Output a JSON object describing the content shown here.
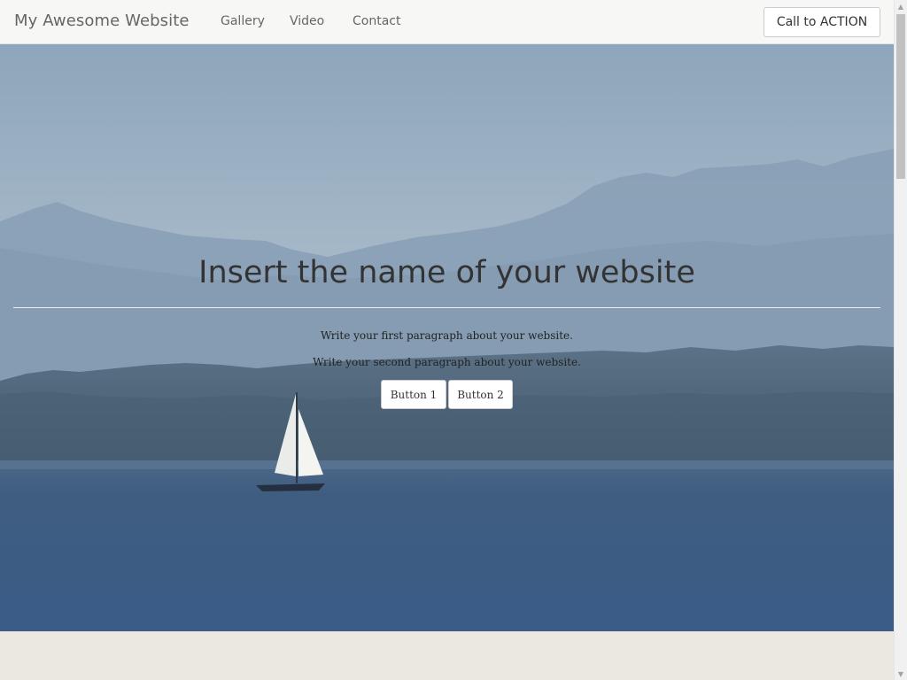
{
  "navbar": {
    "brand": "My Awesome Website",
    "links": [
      "Gallery",
      "Video",
      "Contact"
    ],
    "cta_label": "Call to ACTION"
  },
  "hero": {
    "title": "Insert the name of your website",
    "paragraph_1": "Write your first paragraph about your website.",
    "paragraph_2": "Write your second paragraph about your website.",
    "button_1": "Button 1",
    "button_2": "Button 2"
  },
  "icons": {
    "scroll_up": "scroll-up-arrow-icon",
    "scroll_down": "scroll-down-arrow-icon"
  },
  "colors": {
    "navbar_bg": "#f7f7f6",
    "section_bg": "#ebe8e2",
    "water": "#3b5a7e",
    "sky": "#a7b9c9"
  }
}
